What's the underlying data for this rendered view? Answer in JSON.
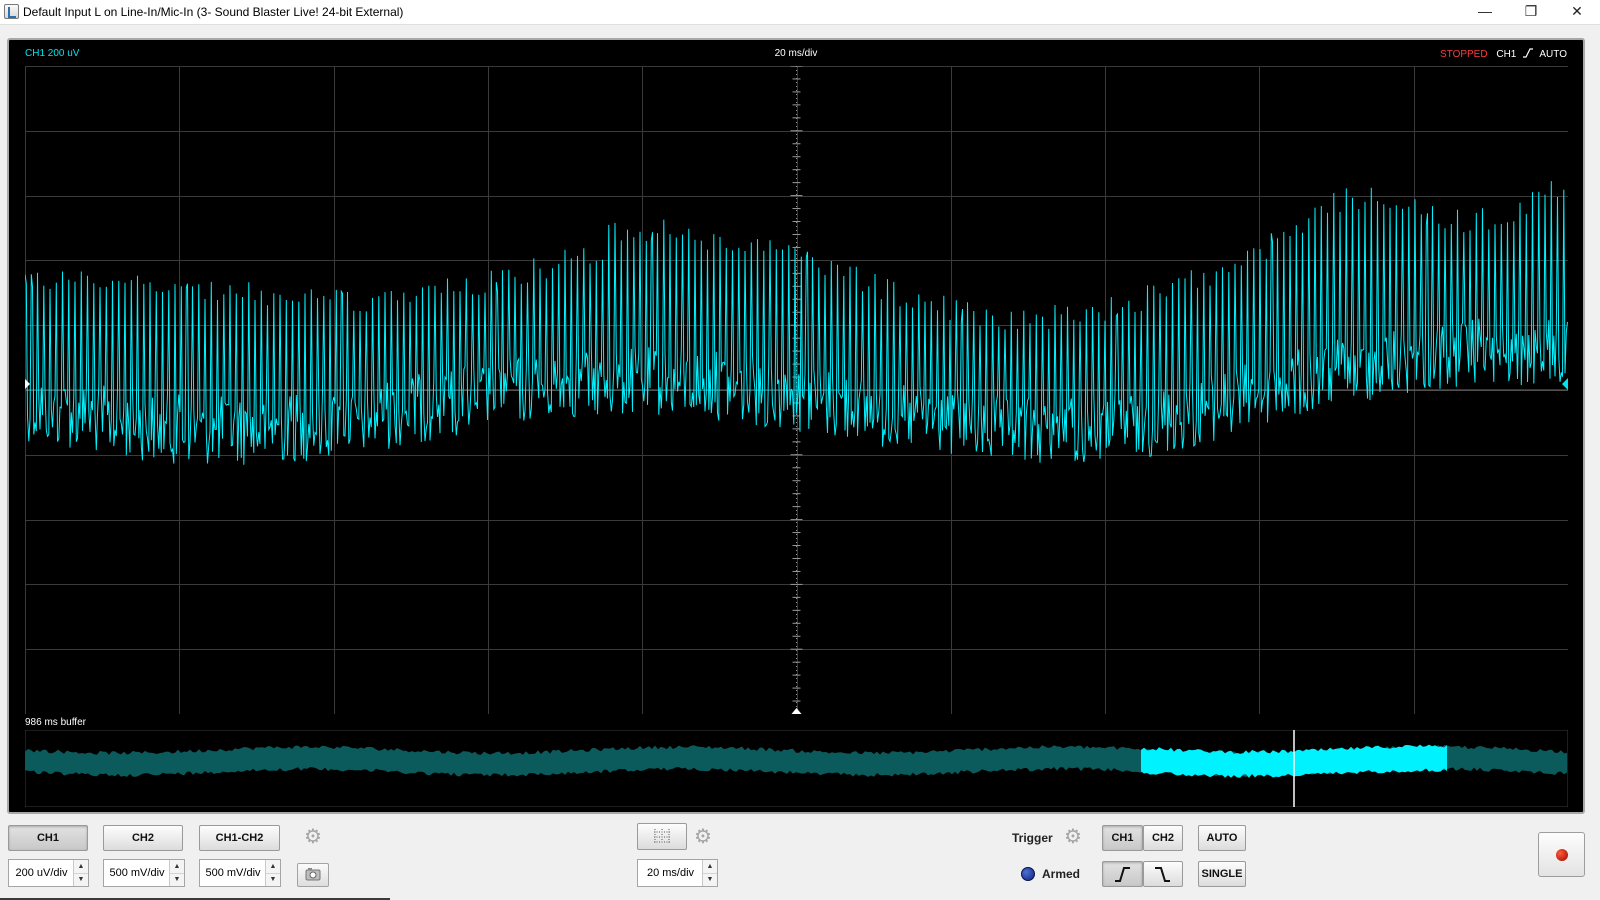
{
  "window": {
    "title": "Default Input L on Line-In/Mic-In (3- Sound Blaster Live! 24-bit External)",
    "minimize_glyph": "—",
    "restore_glyph": "❐",
    "close_glyph": "✕"
  },
  "scope": {
    "ch1_scale": "CH1 200 uV",
    "timebase": "20 ms/div",
    "status_state": "STOPPED",
    "status_source": "CH1",
    "status_mode": "AUTO",
    "buffer_label": "986 ms buffer",
    "trace_color": "#00f2ff",
    "buffer_color": "#0b5a5c",
    "grid_color": "#3a3a3a"
  },
  "controls": {
    "ch1_label": "CH1",
    "ch2_label": "CH2",
    "math_label": "CH1-CH2",
    "ch1_volts": "200 uV/div",
    "ch2_volts": "500 mV/div",
    "math_volts": "500 mV/div",
    "timebase_value": "20 ms/div",
    "trigger_label": "Trigger",
    "trigger_ch1": "CH1",
    "trigger_ch2": "CH2",
    "auto_label": "AUTO",
    "single_label": "SINGLE",
    "armed_label": "Armed",
    "rising_glyph": "∫",
    "falling_glyph": "ʅ",
    "settings_icon": "gear-icon",
    "camera_icon": "camera-icon",
    "grid_icon": "grid-icon",
    "record_icon": "record-icon"
  }
}
